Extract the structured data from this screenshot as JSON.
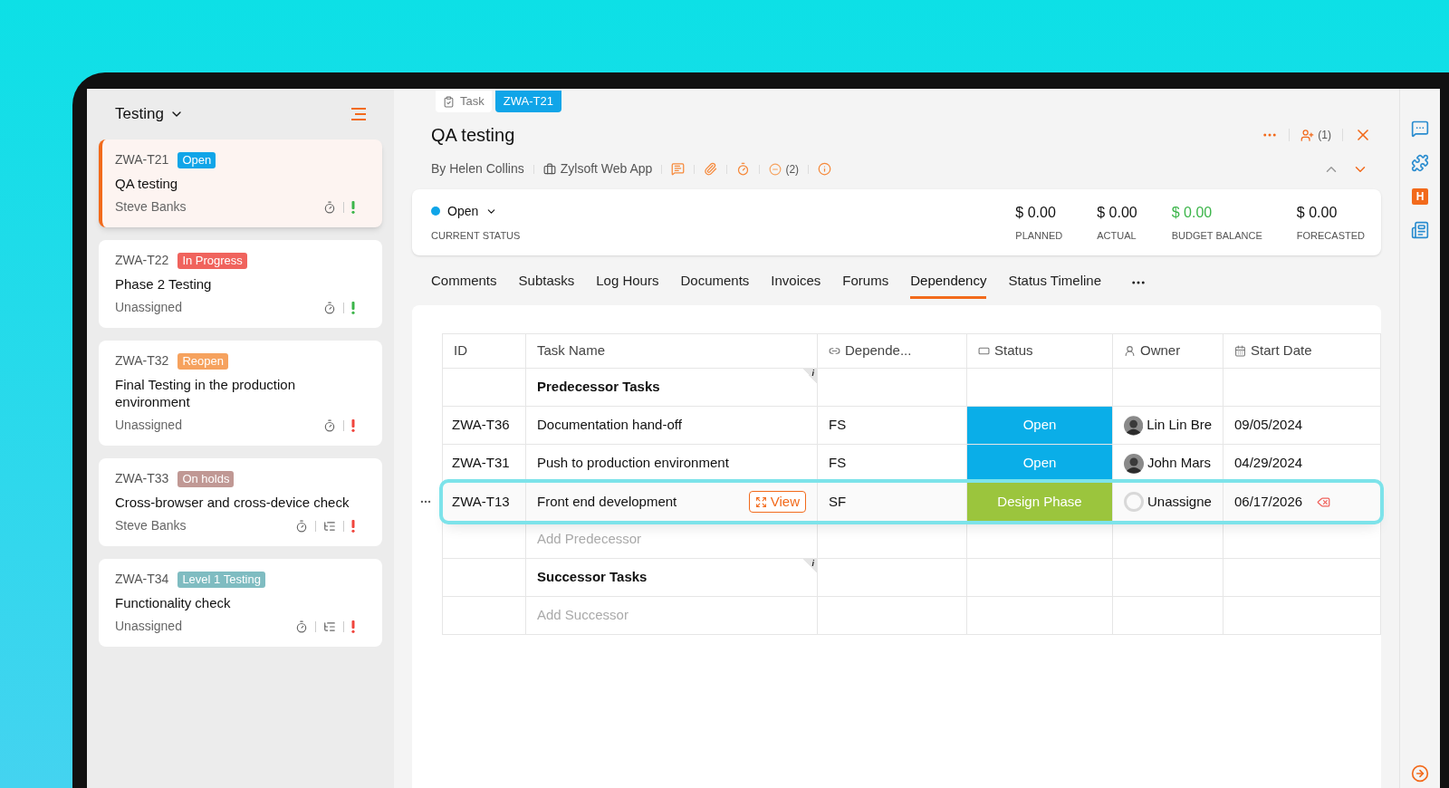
{
  "sidebar": {
    "title": "Testing",
    "tasks": [
      {
        "id": "ZWA-T21",
        "status": {
          "label": "Open",
          "color": "#10a5e8"
        },
        "title": "QA testing",
        "assignee": "Steve Banks",
        "selected": true,
        "has_subtasks": false,
        "color": "#3cb54a"
      },
      {
        "id": "ZWA-T22",
        "status": {
          "label": "In Progress",
          "color": "#f0635d"
        },
        "title": "Phase 2 Testing",
        "assignee": "Unassigned",
        "selected": false,
        "has_subtasks": false,
        "color": "#3cb54a"
      },
      {
        "id": "ZWA-T32",
        "status": {
          "label": "Reopen",
          "color": "#f6a25e"
        },
        "title": "Final Testing in the production environment",
        "assignee": "Unassigned",
        "selected": false,
        "has_subtasks": false,
        "color": "#f0453d"
      },
      {
        "id": "ZWA-T33",
        "status": {
          "label": "On holds",
          "color": "#c09894"
        },
        "title": "Cross-browser and cross-device check",
        "assignee": "Steve Banks",
        "selected": false,
        "has_subtasks": true,
        "color": "#f0453d"
      },
      {
        "id": "ZWA-T34",
        "status": {
          "label": "Level 1 Testing",
          "color": "#7fbcc1"
        },
        "title": "Functionality check",
        "assignee": "Unassigned",
        "selected": false,
        "has_subtasks": true,
        "color": "#f0453d"
      }
    ]
  },
  "detail": {
    "tag": "Task",
    "id": "ZWA-T21",
    "title": "QA testing",
    "author": "By Helen Collins",
    "project": "Zylsoft Web App",
    "blocker_count": "(2)",
    "follower_count": "(1)",
    "status": {
      "label": "Open",
      "color": "#10a5e8",
      "caption": "CURRENT STATUS"
    },
    "amounts": [
      {
        "value": "$ 0.00",
        "label": "PLANNED",
        "color": "#111111"
      },
      {
        "value": "$ 0.00",
        "label": "ACTUAL",
        "color": "#111111"
      },
      {
        "value": "$ 0.00",
        "label": "BUDGET BALANCE",
        "color": "#3cb54a"
      },
      {
        "value": "$ 0.00",
        "label": "FORECASTED",
        "color": "#111111"
      }
    ],
    "tabs": [
      {
        "label": "Comments",
        "selected": false
      },
      {
        "label": "Subtasks",
        "selected": false
      },
      {
        "label": "Log Hours",
        "selected": false
      },
      {
        "label": "Documents",
        "selected": false
      },
      {
        "label": "Invoices",
        "selected": false
      },
      {
        "label": "Forums",
        "selected": false
      },
      {
        "label": "Dependency",
        "selected": true
      },
      {
        "label": "Status Timeline",
        "selected": false
      }
    ]
  },
  "table": {
    "columns": [
      {
        "label": "ID"
      },
      {
        "label": "Task Name"
      },
      {
        "label": "Depende..."
      },
      {
        "label": "Status"
      },
      {
        "label": "Owner"
      },
      {
        "label": "Start Date"
      }
    ],
    "rows": [
      {
        "kind": "section",
        "label": "Predecessor Tasks",
        "mark": "i"
      },
      {
        "kind": "task",
        "id": "ZWA-T36",
        "name": "Documentation hand-off",
        "dependency": "FS",
        "status": {
          "label": "Open",
          "color": "#0aaee8"
        },
        "owner": {
          "name": "Lin Lin Bre",
          "assigned": true
        },
        "start_date": "09/05/2024",
        "highlighted": false
      },
      {
        "kind": "task",
        "id": "ZWA-T31",
        "name": "Push to production environment",
        "dependency": "FS",
        "status": {
          "label": "Open",
          "color": "#0aaee8"
        },
        "owner": {
          "name": "John Mars",
          "assigned": true
        },
        "start_date": "04/29/2024",
        "highlighted": false
      },
      {
        "kind": "task",
        "id": "ZWA-T13",
        "name": "Front end development",
        "dependency": "SF",
        "status": {
          "label": "Design Phase",
          "color": "#9bc53d"
        },
        "owner": {
          "name": "Unassigne",
          "assigned": false
        },
        "start_date": "06/17/2026",
        "highlighted": true,
        "view_label": "View"
      },
      {
        "kind": "add",
        "label": "Add Predecessor"
      },
      {
        "kind": "section",
        "label": "Successor Tasks",
        "mark": "i"
      },
      {
        "kind": "add",
        "label": "Add Successor"
      }
    ]
  },
  "rail": {
    "badge": "H"
  }
}
